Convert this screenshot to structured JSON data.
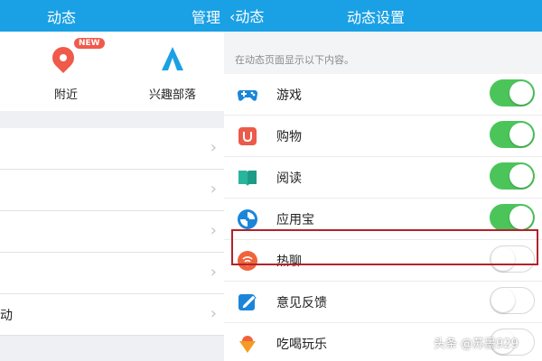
{
  "left": {
    "title": "动态",
    "manage": "管理",
    "entries": {
      "near_badge": "NEW",
      "near_label": "附近",
      "interest_label": "兴趣部落"
    },
    "rows": [
      {
        "label": ""
      },
      {
        "label": ""
      },
      {
        "label": ""
      },
      {
        "label": ""
      },
      {
        "label": "动"
      }
    ]
  },
  "right": {
    "back_label": "动态",
    "title": "动态设置",
    "hint": "在动态页面显示以下内容。",
    "items": [
      {
        "label": "游戏",
        "icon": "gamepad-icon",
        "on": true
      },
      {
        "label": "购物",
        "icon": "shopping-icon",
        "on": true
      },
      {
        "label": "阅读",
        "icon": "book-icon",
        "on": true
      },
      {
        "label": "应用宝",
        "icon": "app-store-icon",
        "on": true
      },
      {
        "label": "热聊",
        "icon": "hot-chat-icon",
        "on": false
      },
      {
        "label": "意见反馈",
        "icon": "feedback-icon",
        "on": false
      },
      {
        "label": "吃喝玩乐",
        "icon": "food-icon",
        "on": false
      }
    ]
  },
  "watermark": "头条 @苏墨929",
  "colors": {
    "header": "#1aa0e5",
    "toggle_on": "#4bc55a",
    "highlight": "#b2232b"
  }
}
